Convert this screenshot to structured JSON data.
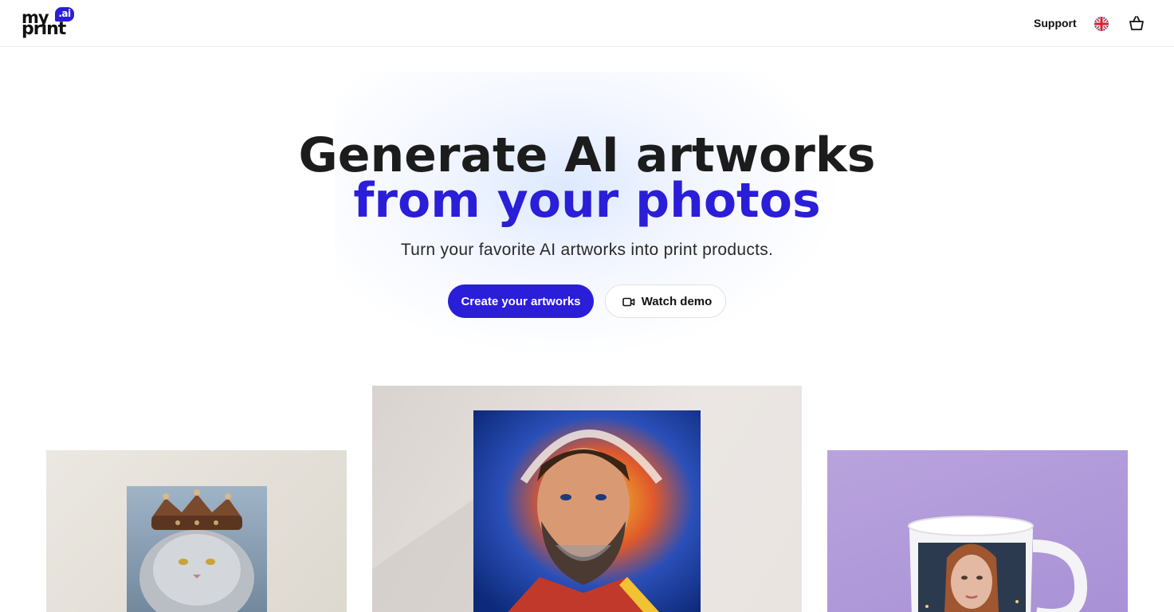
{
  "header": {
    "logo": {
      "top_text": "my",
      "bottom_text": "print",
      "badge_text": ".ai"
    },
    "nav": {
      "support_label": "Support"
    },
    "language_icon": "uk-flag-icon",
    "cart_icon": "basket-icon"
  },
  "hero": {
    "headline_line1": "Generate AI artworks",
    "headline_line2": "from your photos",
    "subtitle": "Turn your favorite AI artworks into print products.",
    "primary_button": "Create your artworks",
    "secondary_button": "Watch demo",
    "secondary_button_icon": "video-camera-icon"
  },
  "products": [
    {
      "name": "canvas-print-cat-king"
    },
    {
      "name": "canvas-print-bearded-man"
    },
    {
      "name": "mug-print-woman-portrait"
    }
  ],
  "colors": {
    "accent": "#2a1ed9",
    "headline": "#1c1c1c",
    "mug_background": "#b9a3dd"
  }
}
